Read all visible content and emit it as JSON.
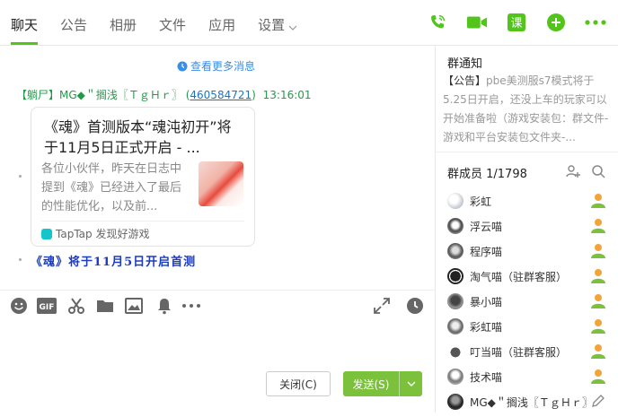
{
  "tabs": [
    {
      "label": "聊天",
      "active": true
    },
    {
      "label": "公告",
      "active": false
    },
    {
      "label": "相册",
      "active": false
    },
    {
      "label": "文件",
      "active": false
    },
    {
      "label": "应用",
      "active": false
    },
    {
      "label": "设置",
      "active": false
    }
  ],
  "top_icons": [
    "phone-icon",
    "video-icon",
    "course-icon",
    "plus-icon",
    "more-icon"
  ],
  "top_course_label": "课",
  "colors": {
    "accent": "#52c41a",
    "send": "#7cc13c",
    "link": "#3a8ee6",
    "sender": "#239a4a"
  },
  "chat": {
    "load_more": "查看更多消息",
    "sender": {
      "name": "【躺尸】MG◆＂搁浅〖ＴｇＨｒ〗",
      "qq_open": "(",
      "qq": "460584721",
      "qq_close": ")",
      "time": "13:16:01"
    },
    "card": {
      "title": "《魂》首测版本“魂沌初开”将于11月5日正式开启 - ...",
      "desc": "各位小伙伴，昨天在日志中提到《魂》已经进入了最后的性能优化，以及前...",
      "source": "TapTap 发现好游戏"
    },
    "message2": "《魂》将于11月5日开启首测"
  },
  "toolbar": {
    "tools": [
      "emoji-icon",
      "gif-icon",
      "scissors-icon",
      "folder-icon",
      "image-icon",
      "bell-icon",
      "more-dots-icon",
      "expand-icon",
      "history-icon"
    ],
    "gif_label": "GIF"
  },
  "buttons": {
    "close": "关闭(C)",
    "send": "发送(S)"
  },
  "sidebar": {
    "notice_title": "群通知",
    "notice_tag": "【公告】",
    "notice_text": "pbe美测服s7模式将于5.25日开启，还没上车的玩家可以开始准备啦（游戏安装包：群文件-游戏和平台安装包文件夹-...",
    "members_title": "群成员 1/1798",
    "members": [
      {
        "name": "彩虹",
        "role": "admin"
      },
      {
        "name": "浮云喵",
        "role": "admin"
      },
      {
        "name": "程序喵",
        "role": "admin"
      },
      {
        "name": "淘气喵（驻群客服）",
        "role": "admin"
      },
      {
        "name": "暴小喵",
        "role": "admin"
      },
      {
        "name": "彩虹喵",
        "role": "admin"
      },
      {
        "name": "叮当喵（驻群客服）",
        "role": "admin"
      },
      {
        "name": "技术喵",
        "role": "admin"
      },
      {
        "name": "MG◆＂搁浅〖ＴｇＨｒ〗",
        "role": "owner"
      }
    ]
  }
}
